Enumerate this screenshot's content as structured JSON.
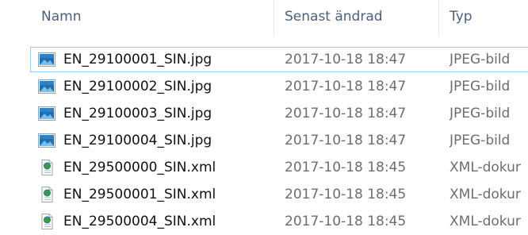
{
  "columns": {
    "name": "Namn",
    "modified": "Senast ändrad",
    "type": "Typ"
  },
  "files": [
    {
      "name": "EN_29100001_SIN.jpg",
      "modified": "2017-10-18 18:47",
      "type": "JPEG-bild",
      "icon": "image-file-icon"
    },
    {
      "name": "EN_29100002_SIN.jpg",
      "modified": "2017-10-18 18:47",
      "type": "JPEG-bild",
      "icon": "image-file-icon"
    },
    {
      "name": "EN_29100003_SIN.jpg",
      "modified": "2017-10-18 18:47",
      "type": "JPEG-bild",
      "icon": "image-file-icon"
    },
    {
      "name": "EN_29100004_SIN.jpg",
      "modified": "2017-10-18 18:47",
      "type": "JPEG-bild",
      "icon": "image-file-icon"
    },
    {
      "name": "EN_29500000_SIN.xml",
      "modified": "2017-10-18 18:45",
      "type": "XML-dokur",
      "icon": "xml-file-icon"
    },
    {
      "name": "EN_29500001_SIN.xml",
      "modified": "2017-10-18 18:45",
      "type": "XML-dokur",
      "icon": "xml-file-icon"
    },
    {
      "name": "EN_29500004_SIN.xml",
      "modified": "2017-10-18 18:45",
      "type": "XML-dokur",
      "icon": "xml-file-icon"
    }
  ],
  "selected_index": 0,
  "colors": {
    "header_text": "#4c607a",
    "selection_border": "#99c9ef",
    "secondary_text": "#6d6d6d"
  }
}
